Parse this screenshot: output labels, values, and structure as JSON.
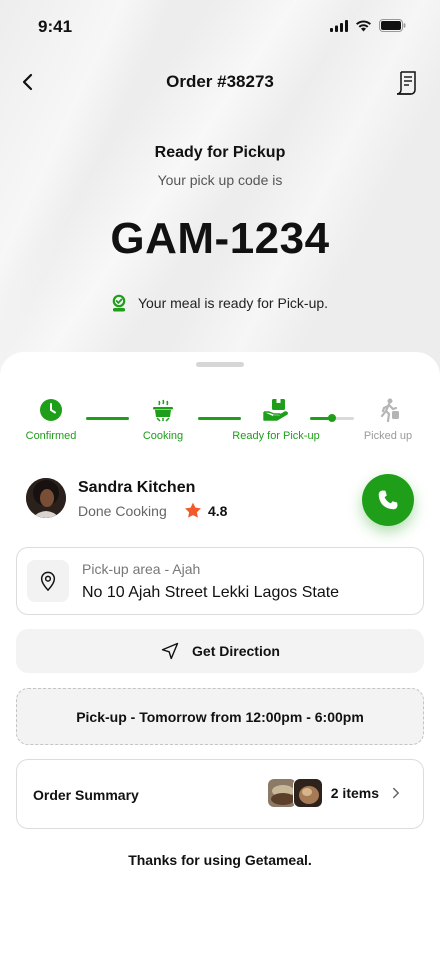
{
  "status_bar": {
    "time": "9:41"
  },
  "header": {
    "title": "Order #38273"
  },
  "hero": {
    "title": "Ready for Pickup",
    "subtitle": "Your pick up code is",
    "code": "GAM-1234",
    "note": "Your meal is ready for Pick-up."
  },
  "progress": {
    "steps": [
      {
        "label": "Confirmed",
        "state": "done"
      },
      {
        "label": "Cooking",
        "state": "done"
      },
      {
        "label": "Ready for Pick-up",
        "state": "current"
      },
      {
        "label": "Picked up",
        "state": "pending"
      }
    ]
  },
  "vendor": {
    "name": "Sandra Kitchen",
    "status": "Done Cooking",
    "rating": "4.8"
  },
  "address": {
    "label": "Pick-up area - Ajah",
    "value": "No 10 Ajah Street Lekki Lagos State"
  },
  "direction": {
    "label": "Get Direction"
  },
  "pickup_time": {
    "text": "Pick-up - Tomorrow from 12:00pm - 6:00pm"
  },
  "order_summary": {
    "label": "Order Summary",
    "count": "2 items"
  },
  "footer": {
    "thanks": "Thanks for using Getameal."
  },
  "colors": {
    "accent": "#1f9e1a",
    "star": "#f25a2b",
    "muted": "#9a9a9a"
  }
}
